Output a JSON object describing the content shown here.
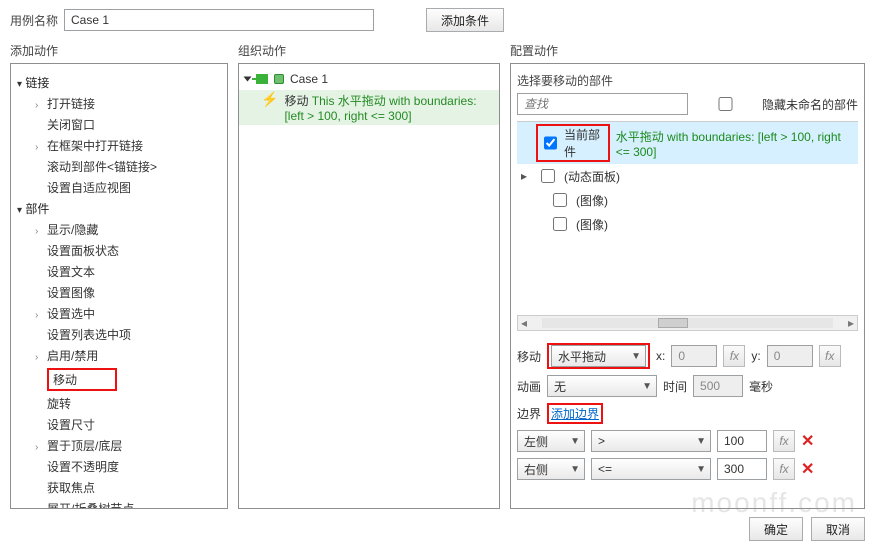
{
  "labels": {
    "caseNameLabel": "用例名称",
    "addCondition": "添加条件",
    "addActionTitle": "添加动作",
    "orgActionTitle": "组织动作",
    "cfgActionTitle": "配置动作",
    "selectWidgetTitle": "选择要移动的部件",
    "searchPlaceholder": "查找",
    "hideUnnamed": "隐藏未命名的部件",
    "moveLabel": "移动",
    "x": "x:",
    "y": "y:",
    "fx": "fx",
    "animLabel": "动画",
    "timeLabel": "时间",
    "msSuffix": "毫秒",
    "boundaryLabel": "边界",
    "addBoundary": "添加边界",
    "ok": "确定",
    "cancel": "取消"
  },
  "caseName": "Case 1",
  "tree": {
    "group1": "链接",
    "g1": {
      "open": "打开链接",
      "close": "关闭窗口",
      "frame": "在框架中打开链接",
      "scroll": "滚动到部件<锚链接>",
      "adaptive": "设置自适应视图"
    },
    "group2": "部件",
    "g2": {
      "show": "显示/隐藏",
      "panel": "设置面板状态",
      "text": "设置文本",
      "image": "设置图像",
      "sel": "设置选中",
      "list": "设置列表选中项",
      "enable": "启用/禁用",
      "move": "移动",
      "rotate": "旋转",
      "size": "设置尺寸",
      "layer": "置于顶层/底层",
      "opacity": "设置不透明度",
      "focus": "获取焦点",
      "tree": "展开/折叠树节点"
    }
  },
  "org": {
    "caseNode": "Case 1",
    "actionLabel": "移动",
    "actionDesc": "This 水平拖动 with boundaries: [left > 100, right <= 300]"
  },
  "widgets": {
    "cur": "当前部件",
    "curDesc": "水平拖动 with boundaries: [left > 100, right <= 300]",
    "panel": "(动态面板)",
    "img1": "(图像)",
    "img2": "(图像)"
  },
  "move": {
    "mode": "水平拖动",
    "xVal": "0",
    "yVal": "0",
    "anim": "无",
    "time": "500"
  },
  "bounds": {
    "row1": {
      "side": "左侧",
      "op": ">",
      "val": "100"
    },
    "row2": {
      "side": "右侧",
      "op": "<=",
      "val": "300"
    }
  },
  "watermark": "moonff.com"
}
